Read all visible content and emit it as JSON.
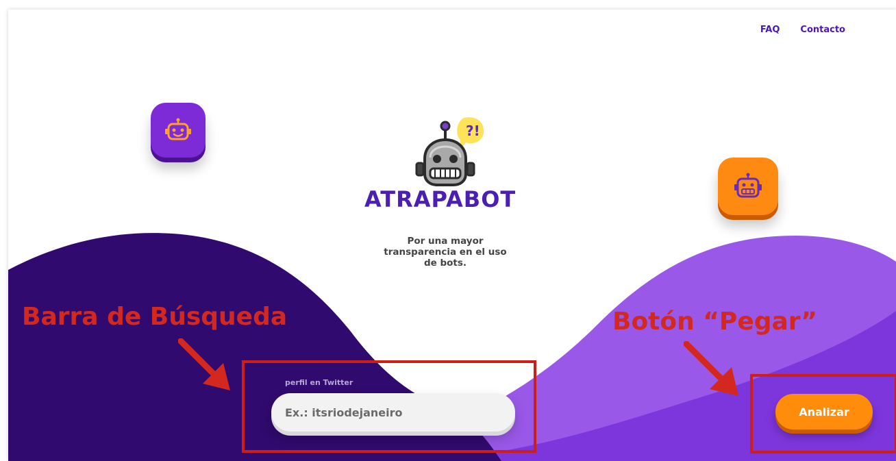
{
  "nav": {
    "links": [
      {
        "label": "FAQ"
      },
      {
        "label": "Contacto"
      }
    ]
  },
  "brand": {
    "name": "ATRAPABOT",
    "tagline": "Por una mayor transparencia en el uso de bots.",
    "badge_text": "?!"
  },
  "icons": {
    "left_float": "robot-icon",
    "right_float": "robot-icon",
    "mascot": "robot-mascot-icon"
  },
  "annotations": {
    "search_bar_label": "Barra de Búsqueda",
    "paste_button_label": "Botón “Pegar”"
  },
  "search": {
    "label": "perfil en Twitter",
    "placeholder": "Ex.: itsriodejaneiro",
    "value": ""
  },
  "actions": {
    "analyze_label": "Analizar"
  },
  "colors": {
    "deep_purple": "#300a6e",
    "purple": "#7b2fd4",
    "light_purple": "#9a58e8",
    "orange": "#ff8c0a",
    "annotation_red": "#d3281f",
    "brand_purple": "#4b1eb4"
  }
}
